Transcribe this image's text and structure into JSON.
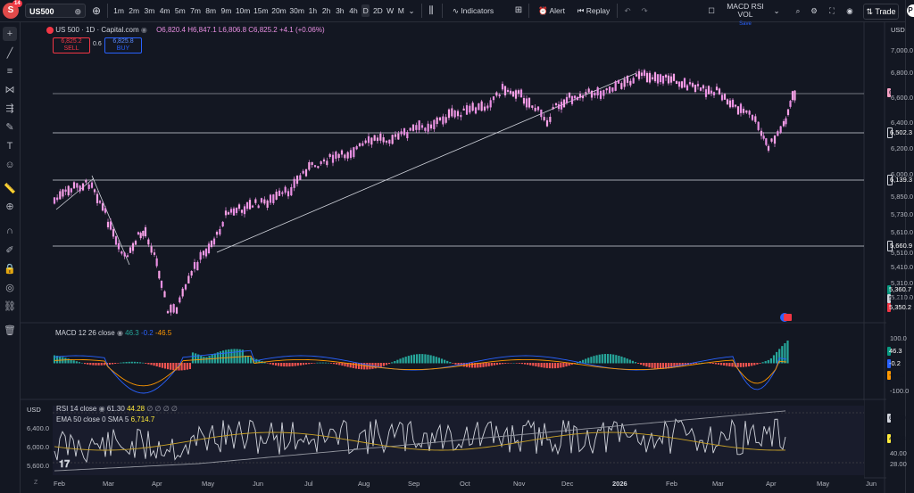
{
  "toolbar": {
    "logo_letter": "S",
    "logo_badge": "14",
    "symbol": "US500",
    "intervals": [
      "1m",
      "2m",
      "3m",
      "4m",
      "5m",
      "7m",
      "8m",
      "9m",
      "10m",
      "15m",
      "20m",
      "30m",
      "1h",
      "2h",
      "3h",
      "4h",
      "D",
      "2D",
      "W",
      "M"
    ],
    "active_interval": "D",
    "indicators_label": "Indicators",
    "alert_label": "Alert",
    "replay_label": "Replay",
    "layout_name": "MACD RSI VOL",
    "layout_sub": "Save",
    "trade_label": "Trade",
    "profile_letter": "P"
  },
  "legend": {
    "title": "US 500 · 1D · Capital.com",
    "ohlc": "O6,820.4 H6,847.1 L6,806.8 C6,825.2 +4.1 (+0.06%)",
    "sell_price": "6,825.2",
    "sell_label": "SELL",
    "spread": "0.6",
    "buy_price": "6,825.8",
    "buy_label": "BUY"
  },
  "currency": "USD",
  "price_axis": [
    "7,000.0",
    "6,800.0",
    "6,600.0",
    "6,400.0",
    "6,200.0",
    "6,000.0",
    "5,850.0",
    "5,730.0",
    "5,610.0",
    "5,510.0",
    "5,410.0",
    "5,310.0",
    "5,210.0"
  ],
  "price_tags": [
    {
      "text": "6,825.2",
      "bg": "#f7a1c4",
      "fg": "#131722"
    },
    {
      "text": "6,502.3",
      "bg": "#131722",
      "fg": "#ffffff"
    },
    {
      "text": "6,139.3",
      "bg": "#131722",
      "fg": "#ffffff"
    },
    {
      "text": "5,660.9",
      "bg": "#131722",
      "fg": "#ffffff"
    },
    {
      "text": "5,360.7",
      "bg": "#089981",
      "fg": "#ffffff"
    },
    {
      "text": "5,356.0",
      "bg": "#d1d4dc",
      "fg": "#131722"
    },
    {
      "text": "5,350.2",
      "bg": "#f23645",
      "fg": "#ffffff"
    }
  ],
  "macd": {
    "legend": "MACD 12 26 close",
    "v1": "46.3",
    "v2": "-0.2",
    "v3": "-46.5",
    "axis": [
      "100.0",
      "-100.0"
    ],
    "tags": [
      {
        "text": "46.3",
        "bg": "#089981",
        "fg": "#ffffff"
      },
      {
        "text": "-0.2",
        "bg": "#2962ff",
        "fg": "#ffffff"
      },
      {
        "text": "-46.5",
        "bg": "#ff9800",
        "fg": "#131722"
      }
    ]
  },
  "rsi": {
    "legend": "RSI 14 close",
    "v1": "61.30",
    "v2": "44.28",
    "extra": "∅ ∅ ∅ ∅",
    "ema_legend": "EMA 50 close 0 SMA 5",
    "ema_value": "6,714.7",
    "axis_right": [
      "40.00",
      "28.00"
    ],
    "axis_left": [
      "6,400.0",
      "6,000.0",
      "5,600.0"
    ],
    "currency_left": "USD",
    "tags": [
      {
        "text": "61.30",
        "bg": "#d1d4dc",
        "fg": "#131722"
      },
      {
        "text": "44.28",
        "bg": "#ffeb3b",
        "fg": "#131722"
      }
    ]
  },
  "time_axis": [
    "Feb",
    "Mar",
    "Apr",
    "May",
    "Jun",
    "Jul",
    "Aug",
    "Sep",
    "Oct",
    "Nov",
    "Dec",
    "2026",
    "Feb",
    "Mar",
    "Apr",
    "May",
    "Jun"
  ],
  "colors": {
    "bg": "#131722",
    "candle": "#e98fe3",
    "macd_line": "#2962ff",
    "signal_line": "#ff9800",
    "hist_up": "#26a69a",
    "hist_down": "#ef5350"
  },
  "icons": [
    "crosshair-icon",
    "trendline-icon",
    "fib-icon",
    "pattern-icon",
    "forecast-icon",
    "brush-icon",
    "text-icon",
    "emoji-icon",
    "ruler-icon",
    "zoom-icon",
    "magnet-icon",
    "lock-draw-icon",
    "lock-icon",
    "eye-icon",
    "link-icon",
    "trash-icon"
  ]
}
